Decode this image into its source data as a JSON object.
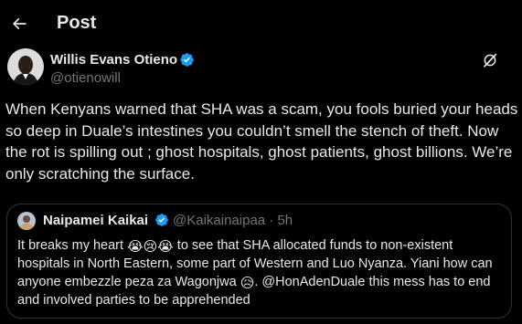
{
  "header": {
    "title": "Post"
  },
  "post": {
    "author_name": "Willis Evans Otieno",
    "author_handle": "@otienowill",
    "text": "When Kenyans warned that SHA was a scam, you fools buried your heads so deep in Duale’s intestines you couldn’t smell the stench of theft. Now the rot is spilling out ; ghost hospitals, ghost patients, ghost billions. We’re only scratching the surface."
  },
  "quote": {
    "author_name": "Naipamei Kaikai",
    "author_handle": "@Kaikainaipaa · 5h",
    "text_1": "It breaks my heart ",
    "emoji_1": "😭😢😭",
    "text_2": " to see that SHA allocated funds to non-existent hospitals in North Eastern, some part of Western and Luo Nyanza. Yiani how can anyone embezzle peza za Wagonjwa ",
    "emoji_2": "😥",
    "text_3": ". @HonAdenDuale this mess has to end and involved parties to be apprehended"
  },
  "colors": {
    "background": "#000000",
    "text": "#e7e9ea",
    "muted": "#71767b",
    "verified": "#1d9bf0",
    "border": "#2f3336"
  },
  "icons": [
    "back-arrow-icon",
    "verified-badge-icon",
    "grok-icon"
  ]
}
